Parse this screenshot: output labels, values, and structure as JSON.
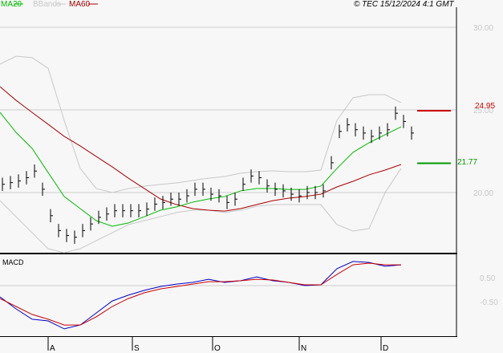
{
  "header": {
    "ma20": "MA20",
    "bbands": "BBands",
    "ma60": "MA60",
    "copyright": "© TEC 15/12/2024 4:1 GMT"
  },
  "colors": {
    "ma20": "#00bb00",
    "bbands": "#c8c8c8",
    "ma60": "#aa0000",
    "macd": "#0000cc",
    "signal": "#cc0000",
    "resistance": "#cc0000",
    "support": "#009900"
  },
  "chart_data": [
    {
      "type": "line",
      "title": "Price",
      "ylim": [
        16,
        31.5
      ],
      "yticks": [
        {
          "v": 30,
          "label": "30.00"
        },
        {
          "v": 25,
          "label": "25.00"
        },
        {
          "v": 20,
          "label": "20.00"
        }
      ],
      "xticks": [
        "A",
        "S",
        "O",
        "N",
        "D"
      ],
      "closes": [
        20.5,
        20.6,
        20.7,
        20.9,
        21.3,
        20.2,
        18.6,
        17.7,
        17.4,
        17.3,
        17.7,
        18.1,
        18.5,
        18.7,
        18.9,
        18.9,
        18.9,
        18.9,
        19.0,
        19.3,
        19.4,
        19.6,
        19.6,
        19.8,
        20.2,
        20.2,
        19.9,
        19.8,
        19.4,
        19.6,
        20.5,
        21.0,
        20.9,
        20.4,
        20.2,
        20.1,
        19.9,
        19.8,
        20.0,
        20.0,
        20.1,
        21.8,
        23.7,
        24.1,
        23.8,
        23.6,
        23.4,
        23.6,
        23.8,
        24.8,
        24.3,
        23.6
      ],
      "ma20": [
        24.85,
        23.64,
        22.67,
        21.21,
        19.76,
        19.03,
        18.3,
        17.96,
        18.16,
        18.54,
        18.93,
        19.13,
        19.42,
        19.61,
        19.76,
        20.1,
        20.24,
        20.24,
        20.19,
        20.19,
        20.39,
        21.46,
        22.43,
        23.01,
        23.5,
        23.98
      ],
      "ma60": [
        26.41,
        25.58,
        24.85,
        24.13,
        23.4,
        22.82,
        22.18,
        21.55,
        20.87,
        20.24,
        19.61,
        19.27,
        19.03,
        18.93,
        18.88,
        19.03,
        19.27,
        19.51,
        19.66,
        19.76,
        19.9,
        20.34,
        20.68,
        21.07,
        21.36,
        21.7
      ],
      "bb_upper": [
        27.77,
        28.25,
        28.16,
        27.52,
        24.37,
        21.46,
        20.24,
        20.0,
        20.24,
        20.39,
        20.49,
        20.58,
        20.73,
        20.87,
        20.97,
        21.17,
        21.26,
        21.31,
        21.26,
        21.26,
        21.36,
        24.37,
        25.73,
        25.92,
        25.92,
        25.44
      ],
      "bb_lower": [
        19.51,
        18.54,
        17.57,
        16.6,
        16.36,
        16.6,
        17.09,
        17.57,
        18.06,
        18.3,
        18.54,
        18.79,
        18.93,
        18.93,
        18.79,
        18.93,
        19.17,
        19.27,
        19.27,
        19.27,
        19.27,
        18.06,
        17.67,
        17.82,
        20.0,
        21.46
      ],
      "resistance": {
        "value": 24.95,
        "label": "24.95"
      },
      "support": {
        "value": 21.77,
        "label": "21.77"
      }
    },
    {
      "type": "line",
      "title": "MACD",
      "ylim": [
        -2.0,
        1.5
      ],
      "yticks": [
        {
          "v": 0.5,
          "label": "0.50"
        },
        {
          "v": -0.5,
          "label": "-0.50"
        }
      ],
      "macd": [
        -0.3,
        -0.8,
        -1.23,
        -1.3,
        -1.63,
        -1.47,
        -0.97,
        -0.47,
        -0.23,
        -0.03,
        0.13,
        0.23,
        0.3,
        0.43,
        0.3,
        0.37,
        0.53,
        0.37,
        0.3,
        0.17,
        0.2,
        0.87,
        1.17,
        1.13,
        0.97,
        1.03
      ],
      "signal": [
        -0.37,
        -0.7,
        -1.03,
        -1.23,
        -1.47,
        -1.47,
        -1.13,
        -0.7,
        -0.37,
        -0.13,
        0.03,
        0.13,
        0.23,
        0.33,
        0.33,
        0.37,
        0.43,
        0.4,
        0.3,
        0.2,
        0.2,
        0.63,
        1.03,
        1.1,
        1.03,
        1.03
      ]
    }
  ]
}
